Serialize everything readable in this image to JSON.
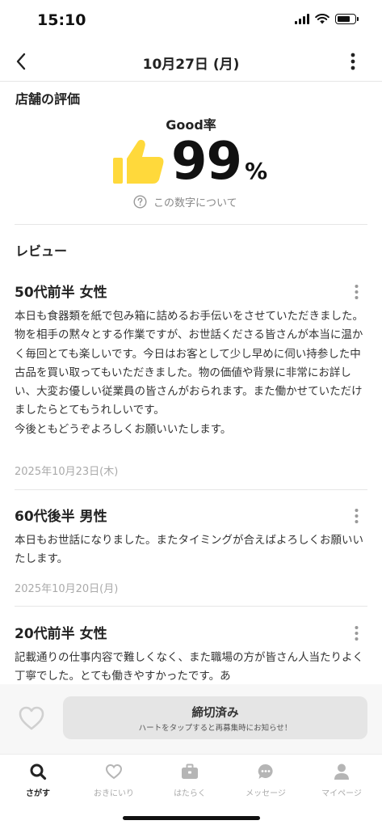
{
  "status": {
    "time": "15:10"
  },
  "nav": {
    "title": "10月27日 (月)"
  },
  "store_rating": {
    "heading": "店舗の評価",
    "good_label": "Good率",
    "value": "99",
    "unit": "%",
    "about_link": "この数字について",
    "accent_color": "#FFD93B"
  },
  "reviews": {
    "heading": "レビュー",
    "items": [
      {
        "author": "50代前半 女性",
        "body": "本日も食器類を紙で包み箱に詰めるお手伝いをさせていただきました。物を相手の黙々とする作業ですが、お世話くださる皆さんが本当に温かく毎回とても楽しいです。今日はお客として少し早めに伺い持参した中古品を買い取ってもいただきました。物の価値や背景に非常にお詳しい、大変お優しい従業員の皆さんがおられます。また働かせていただけましたらとてもうれしいです。\n今後ともどうぞよろしくお願いいたします。",
        "date": "2025年10月23日(木)"
      },
      {
        "author": "60代後半 男性",
        "body": "本日もお世話になりました。またタイミングが合えばよろしくお願いいたします。",
        "date": "2025年10月20日(月)"
      },
      {
        "author": "20代前半 女性",
        "body": "記載通りの仕事内容で難しくなく、また職場の方が皆さん人当たりよく丁寧でした。とても働きやすかったです。あ",
        "date": ""
      }
    ]
  },
  "bottom_action": {
    "closed_label": "締切済み",
    "closed_sub": "ハートをタップすると再募集時にお知らせ！",
    "heart_icon": "heart-outline-icon"
  },
  "tabs": [
    {
      "label": "さがす",
      "icon": "search-icon",
      "active": true
    },
    {
      "label": "おきにいり",
      "icon": "heart-icon",
      "active": false
    },
    {
      "label": "はたらく",
      "icon": "briefcase-icon",
      "active": false
    },
    {
      "label": "メッセージ",
      "icon": "chat-icon",
      "active": false
    },
    {
      "label": "マイページ",
      "icon": "person-icon",
      "active": false
    }
  ]
}
